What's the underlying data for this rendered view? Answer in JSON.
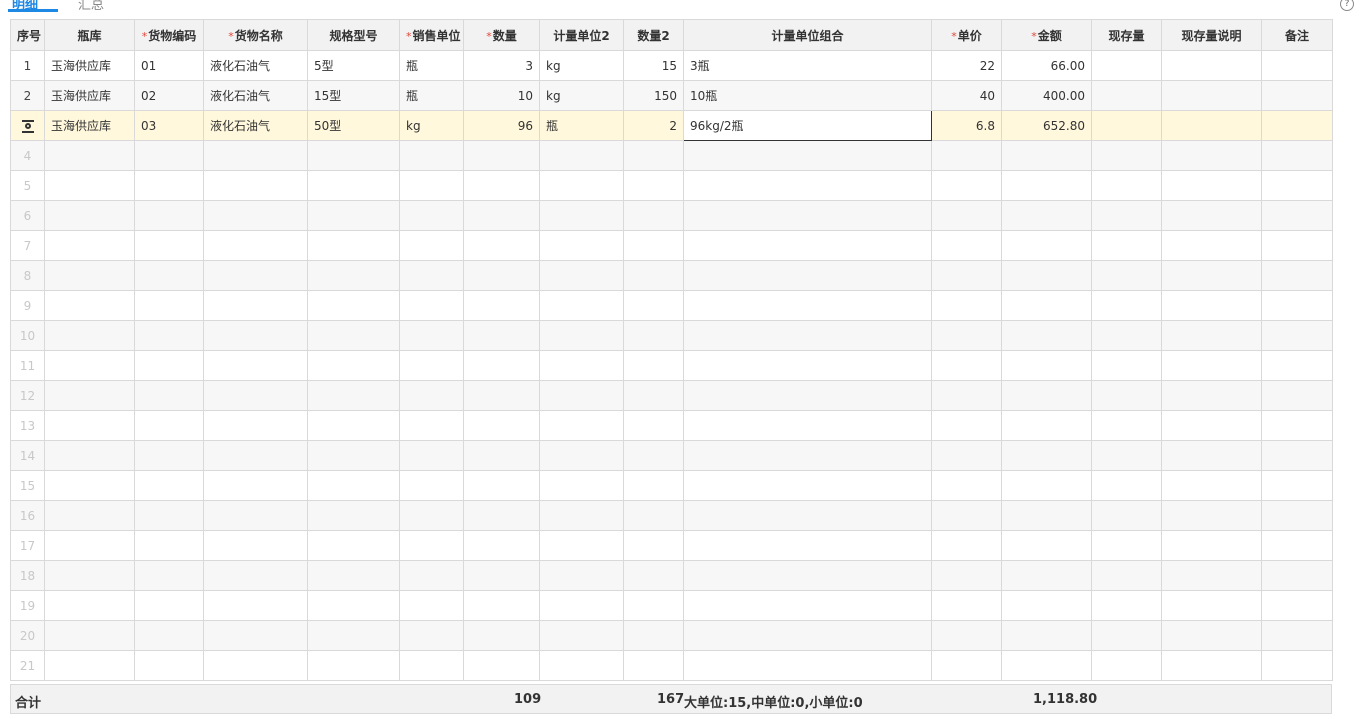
{
  "tabs": [
    {
      "label": "明细",
      "active": true
    },
    {
      "label": "汇总",
      "active": false
    }
  ],
  "colors": {
    "accent": "#1e88e5",
    "required": "#e0463a",
    "highlight_row": "#fff8dc"
  },
  "columns": [
    {
      "label": "序号",
      "required": false
    },
    {
      "label": "瓶库",
      "required": false
    },
    {
      "label": "货物编码",
      "required": true
    },
    {
      "label": "货物名称",
      "required": true
    },
    {
      "label": "规格型号",
      "required": false
    },
    {
      "label": "销售单位",
      "required": true
    },
    {
      "label": "数量",
      "required": true
    },
    {
      "label": "计量单位2",
      "required": false
    },
    {
      "label": "数量2",
      "required": false
    },
    {
      "label": "计量单位组合",
      "required": false
    },
    {
      "label": "单价",
      "required": true
    },
    {
      "label": "金额",
      "required": true
    },
    {
      "label": "现存量",
      "required": false
    },
    {
      "label": "现存量说明",
      "required": false
    },
    {
      "label": "备注",
      "required": false
    }
  ],
  "rows": [
    {
      "idx": "1",
      "warehouse": "玉海供应库",
      "code": "01",
      "name": "液化石油气",
      "spec": "5型",
      "sale_unit": "瓶",
      "qty": "3",
      "unit2": "kg",
      "qty2": "15",
      "combo": "3瓶",
      "price": "22",
      "amount": "66.00",
      "stock": "",
      "stock_note": "",
      "remark": ""
    },
    {
      "idx": "2",
      "warehouse": "玉海供应库",
      "code": "02",
      "name": "液化石油气",
      "spec": "15型",
      "sale_unit": "瓶",
      "qty": "10",
      "unit2": "kg",
      "qty2": "150",
      "combo": "10瓶",
      "price": "40",
      "amount": "400.00",
      "stock": "",
      "stock_note": "",
      "remark": ""
    },
    {
      "idx": "",
      "icon": "row-edit-icon",
      "warehouse": "玉海供应库",
      "code": "03",
      "name": "液化石油气",
      "spec": "50型",
      "sale_unit": "kg",
      "qty": "96",
      "unit2": "瓶",
      "qty2": "2",
      "combo": "96kg/2瓶",
      "price": "6.8",
      "amount": "652.80",
      "stock": "",
      "stock_note": "",
      "remark": ""
    }
  ],
  "empty_rows": [
    "4",
    "5",
    "6",
    "7",
    "8",
    "9",
    "10",
    "11",
    "12",
    "13",
    "14",
    "15",
    "16",
    "17",
    "18",
    "19",
    "20",
    "21"
  ],
  "footer": {
    "label": "合计",
    "qty_total": "109",
    "qty2_total": "167",
    "combo_total": "大单位:15,中单位:0,小单位:0",
    "amount_total": "1,118.80"
  }
}
